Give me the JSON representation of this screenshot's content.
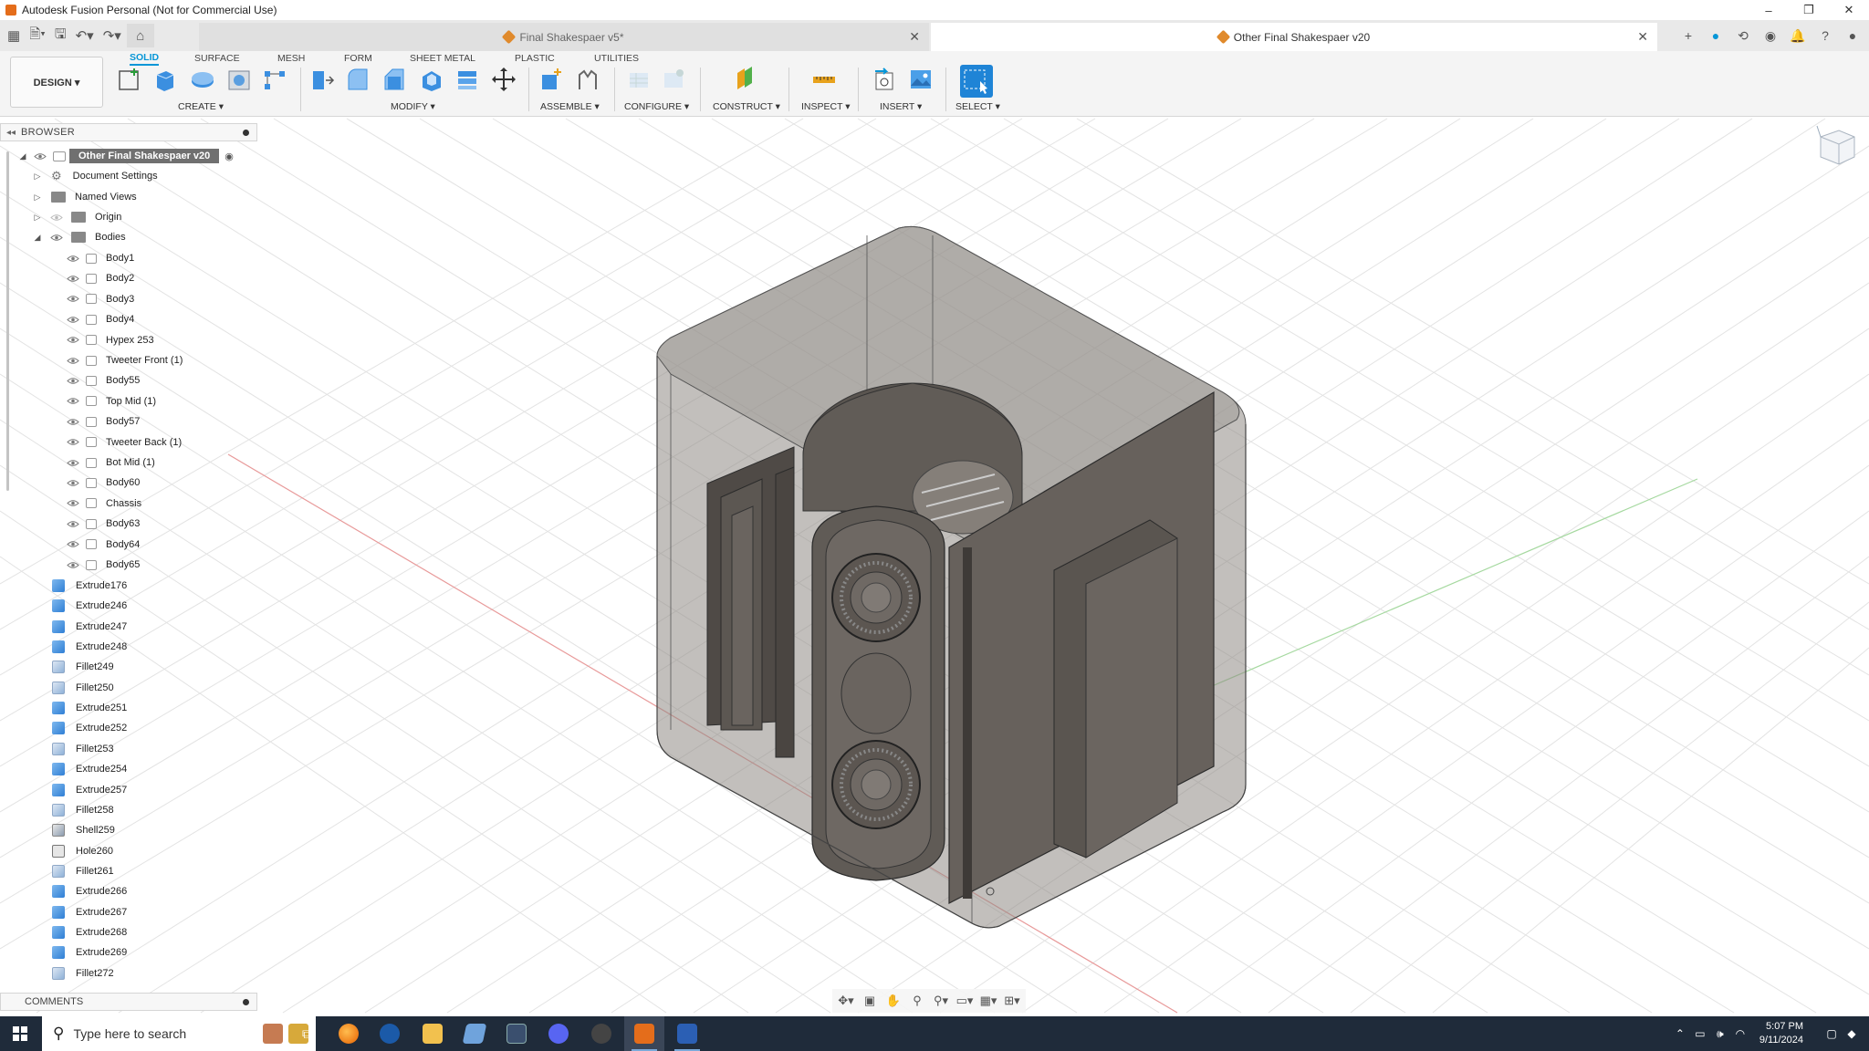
{
  "window": {
    "title": "Autodesk Fusion Personal (Not for Commercial Use)",
    "controls": [
      "–",
      "❐",
      "✕"
    ]
  },
  "tabs": {
    "doc1": "Final Shakespaer v5*",
    "doc2": "Other Final Shakespaer v20"
  },
  "ribbon": {
    "workspace": "DESIGN ▾",
    "tabs": [
      "SOLID",
      "SURFACE",
      "MESH",
      "FORM",
      "SHEET METAL",
      "PLASTIC",
      "UTILITIES"
    ],
    "groups": {
      "create": "CREATE ▾",
      "modify": "MODIFY ▾",
      "assemble": "ASSEMBLE ▾",
      "configure": "CONFIGURE ▾",
      "construct": "CONSTRUCT ▾",
      "inspect": "INSPECT ▾",
      "insert": "INSERT ▾",
      "select": "SELECT ▾"
    }
  },
  "browser": {
    "title": "BROWSER",
    "root": "Other Final Shakespaer v20",
    "folders": [
      "Document Settings",
      "Named Views",
      "Origin",
      "Bodies"
    ],
    "bodies": [
      "Body1",
      "Body2",
      "Body3",
      "Body4",
      "Hypex 253",
      "Tweeter Front (1)",
      "Body55",
      "Top Mid (1)",
      "Body57",
      "Tweeter Back (1)",
      "Bot Mid (1)",
      "Body60",
      "Chassis",
      "Body63",
      "Body64",
      "Body65"
    ],
    "features": [
      {
        "name": "Extrude176",
        "kind": "extrude"
      },
      {
        "name": "Extrude246",
        "kind": "extrude"
      },
      {
        "name": "Extrude247",
        "kind": "extrude"
      },
      {
        "name": "Extrude248",
        "kind": "extrude"
      },
      {
        "name": "Fillet249",
        "kind": "fillet"
      },
      {
        "name": "Fillet250",
        "kind": "fillet"
      },
      {
        "name": "Extrude251",
        "kind": "extrude"
      },
      {
        "name": "Extrude252",
        "kind": "extrude"
      },
      {
        "name": "Fillet253",
        "kind": "fillet"
      },
      {
        "name": "Extrude254",
        "kind": "extrude"
      },
      {
        "name": "Extrude257",
        "kind": "extrude"
      },
      {
        "name": "Fillet258",
        "kind": "fillet"
      },
      {
        "name": "Shell259",
        "kind": "shell"
      },
      {
        "name": "Hole260",
        "kind": "hole"
      },
      {
        "name": "Fillet261",
        "kind": "fillet"
      },
      {
        "name": "Extrude266",
        "kind": "extrude"
      },
      {
        "name": "Extrude267",
        "kind": "extrude"
      },
      {
        "name": "Extrude268",
        "kind": "extrude"
      },
      {
        "name": "Extrude269",
        "kind": "extrude"
      },
      {
        "name": "Fillet272",
        "kind": "fillet"
      }
    ],
    "comments": "COMMENTS"
  },
  "taskbar": {
    "search_placeholder": "Type here to search",
    "time": "5:07 PM",
    "date": "9/11/2024"
  },
  "colors": {
    "accent": "#0696d7",
    "taskbar": "#1f2b3a",
    "fusion_orange": "#e46d1b"
  }
}
